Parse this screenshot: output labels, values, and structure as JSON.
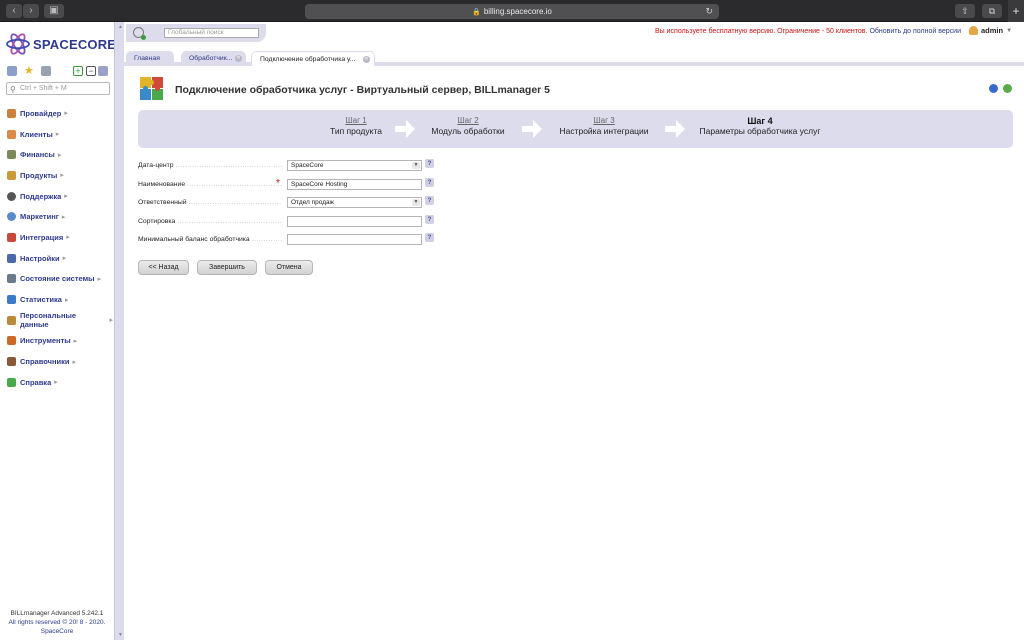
{
  "browser": {
    "url": "billing.spacecore.io"
  },
  "sidebar": {
    "logo_text": "SPACECORE",
    "search_placeholder": "Ctrl + Shift + M",
    "items": [
      {
        "label": "Провайдер",
        "icon": "provider-icon",
        "color": "#c9823e"
      },
      {
        "label": "Клиенты",
        "icon": "clients-icon",
        "color": "#d98b4a"
      },
      {
        "label": "Финансы",
        "icon": "finance-icon",
        "color": "#7a8a5a"
      },
      {
        "label": "Продукты",
        "icon": "products-icon",
        "color": "#c99a3a"
      },
      {
        "label": "Поддержка",
        "icon": "support-icon",
        "color": "#555555"
      },
      {
        "label": "Маркетинг",
        "icon": "marketing-icon",
        "color": "#5a8ac9"
      },
      {
        "label": "Интеграция",
        "icon": "integration-icon",
        "color": "#c94a3a"
      },
      {
        "label": "Настройки",
        "icon": "settings-icon",
        "color": "#4a6aa9"
      },
      {
        "label": "Состояние системы",
        "icon": "system-state-icon",
        "color": "#6a7a8a"
      },
      {
        "label": "Статистика",
        "icon": "statistics-icon",
        "color": "#3a7ac9"
      },
      {
        "label": "Персональные данные",
        "icon": "personal-data-icon",
        "color": "#b98a3a"
      },
      {
        "label": "Инструменты",
        "icon": "tools-icon",
        "color": "#c96a2a"
      },
      {
        "label": "Справочники",
        "icon": "reference-books-icon",
        "color": "#8a5a3a"
      },
      {
        "label": "Справка",
        "icon": "help-icon",
        "color": "#4aa94a"
      }
    ],
    "footer_version": "BILLmanager Advanced 5.242.1",
    "footer_rights": "All rights reserved © 20! 8 - 2020.",
    "footer_company": "SpaceCore"
  },
  "topbar": {
    "global_search_placeholder": "Глобальный поиск",
    "notice_text": "Вы используете бесплатную версию. Ограничение - 50 клиентов.",
    "notice_link": "Обновить до полной версии",
    "user_name": "admin"
  },
  "tabs": [
    {
      "label": "Главная"
    },
    {
      "label": "Обработчик..."
    },
    {
      "label": "Подключение обработчика у..."
    }
  ],
  "page": {
    "title": "Подключение обработчика услуг - Виртуальный сервер, BILLmanager 5"
  },
  "wizard": {
    "steps": [
      {
        "number": "Шаг 1",
        "label": "Тип продукта"
      },
      {
        "number": "Шаг 2",
        "label": "Модуль обработки"
      },
      {
        "number": "Шаг 3",
        "label": "Настройка интеграции"
      },
      {
        "number": "Шаг 4",
        "label": "Параметры обработчика услуг"
      }
    ],
    "current_step": 4
  },
  "form": {
    "fields": [
      {
        "label": "Дата-центр",
        "value": "SpaceCore",
        "type": "select",
        "required": false
      },
      {
        "label": "Наименование",
        "value": "SpaceCore Hosting",
        "type": "text",
        "required": true
      },
      {
        "label": "Ответственный",
        "value": "Отдел продаж",
        "type": "select",
        "required": false
      },
      {
        "label": "Сортировка",
        "value": "",
        "type": "text",
        "required": false
      },
      {
        "label": "Минимальный баланс обработчика",
        "value": "",
        "type": "text",
        "required": false
      }
    ],
    "help_mark": "?",
    "required_mark": "*"
  },
  "buttons": {
    "back": "<< Назад",
    "finish": "Завершить",
    "cancel": "Отмена"
  }
}
